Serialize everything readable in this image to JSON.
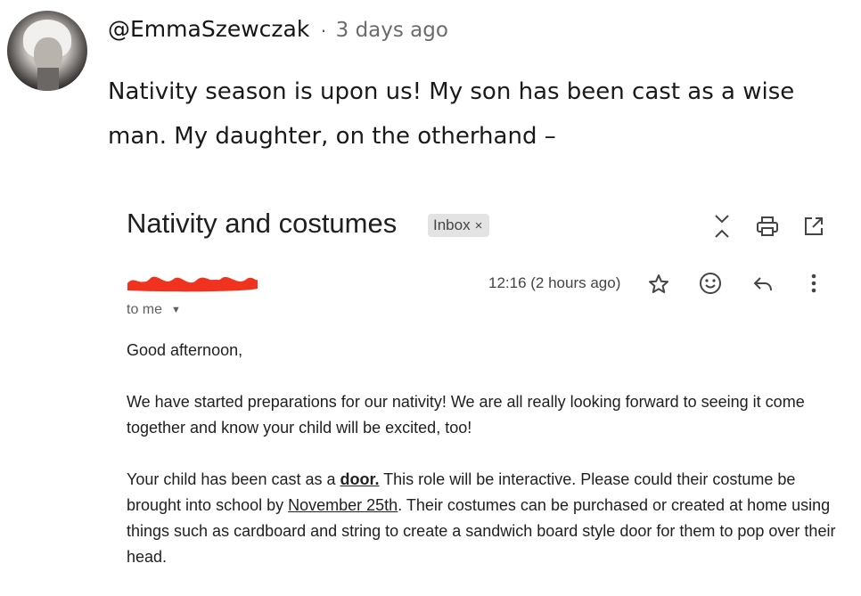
{
  "post": {
    "avatar_alt": "",
    "handle": "@EmmaSzewczak",
    "separator": "·",
    "time": "3 days ago",
    "text": "Nativity season is upon us! My son has been cast as a wise man. My daughter, on the otherhand –"
  },
  "email": {
    "subject": "Nativity and costumes",
    "label": "Inbox",
    "label_close": "×",
    "sender_redacted": true,
    "recipient": "to me",
    "timestamp": "12:16 (2 hours ago)",
    "icons": {
      "collapse": "collapse-icon",
      "print": "print-icon",
      "open_new_window": "open-in-new-icon",
      "star": "star-icon",
      "emoji": "emoji-icon",
      "reply": "reply-icon",
      "more": "more-vert-icon"
    },
    "body": {
      "greeting": "Good afternoon,",
      "p1": "We have started preparations for our nativity! We are all really looking forward to seeing it come together and know your child will be excited, too!",
      "p2_a": "Your child has been cast as a ",
      "p2_role": "door.",
      "p2_b": " This role will be interactive. Please could their costume be brought into school by ",
      "p2_date": "November 25th",
      "p2_c": ". Their costumes can be purchased or created at home using things such as cardboard and string to create a sandwich board style door for them to pop over their head."
    },
    "redaction_color": "#f0321e"
  }
}
